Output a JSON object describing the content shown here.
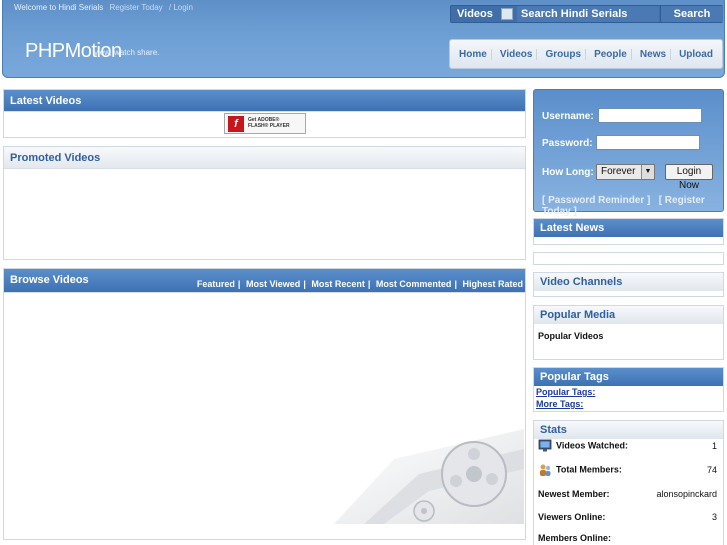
{
  "header": {
    "welcome": "Welcome to Hindi Serials",
    "register_link": "Register Today",
    "login_link": "/ Login",
    "logo": "PHPMotion",
    "tagline": "view, watch share.",
    "search_scope": "Videos",
    "search_placeholder": "Search Hindi Serials",
    "search_button": "Search",
    "nav": [
      "Home",
      "Videos",
      "Groups",
      "People",
      "News",
      "Upload"
    ]
  },
  "main": {
    "latest_videos_title": "Latest Videos",
    "flash_line1": "Get ADOBE®",
    "flash_line2": "FLASH® PLAYER",
    "promoted_title": "Promoted Videos",
    "browse_title": "Browse Videos",
    "browse_links": [
      "Featured",
      "Most Viewed",
      "Most Recent",
      "Most Commented",
      "Highest Rated"
    ]
  },
  "login": {
    "username_label": "Username:",
    "password_label": "Password:",
    "how_long_label": "How Long:",
    "how_long_value": "Forever",
    "login_button": "Login Now",
    "password_reminder": "[ Password Reminder ]",
    "register": "[ Register Today ]"
  },
  "sidebar": {
    "latest_news_title": "Latest News",
    "video_channels_title": "Video Channels",
    "popular_media_title": "Popular Media",
    "popular_videos": "Popular Videos",
    "popular_tags_title": "Popular Tags",
    "popular_tags_link": "Popular Tags:",
    "more_tags_link": "More Tags:",
    "stats_title": "Stats",
    "stats": [
      {
        "label": "Videos Watched:",
        "value": "1"
      },
      {
        "label": "Total Members:",
        "value": "74"
      },
      {
        "label": "Newest Member:",
        "value": "alonsopinckard"
      },
      {
        "label": "Viewers Online:",
        "value": "3"
      },
      {
        "label": "Members Online:",
        "value": ""
      }
    ]
  },
  "colors": {
    "header_blue": "#6e9fd4",
    "panel_header_blue": "#3d71b3",
    "link_blue": "#1b3aa0"
  }
}
